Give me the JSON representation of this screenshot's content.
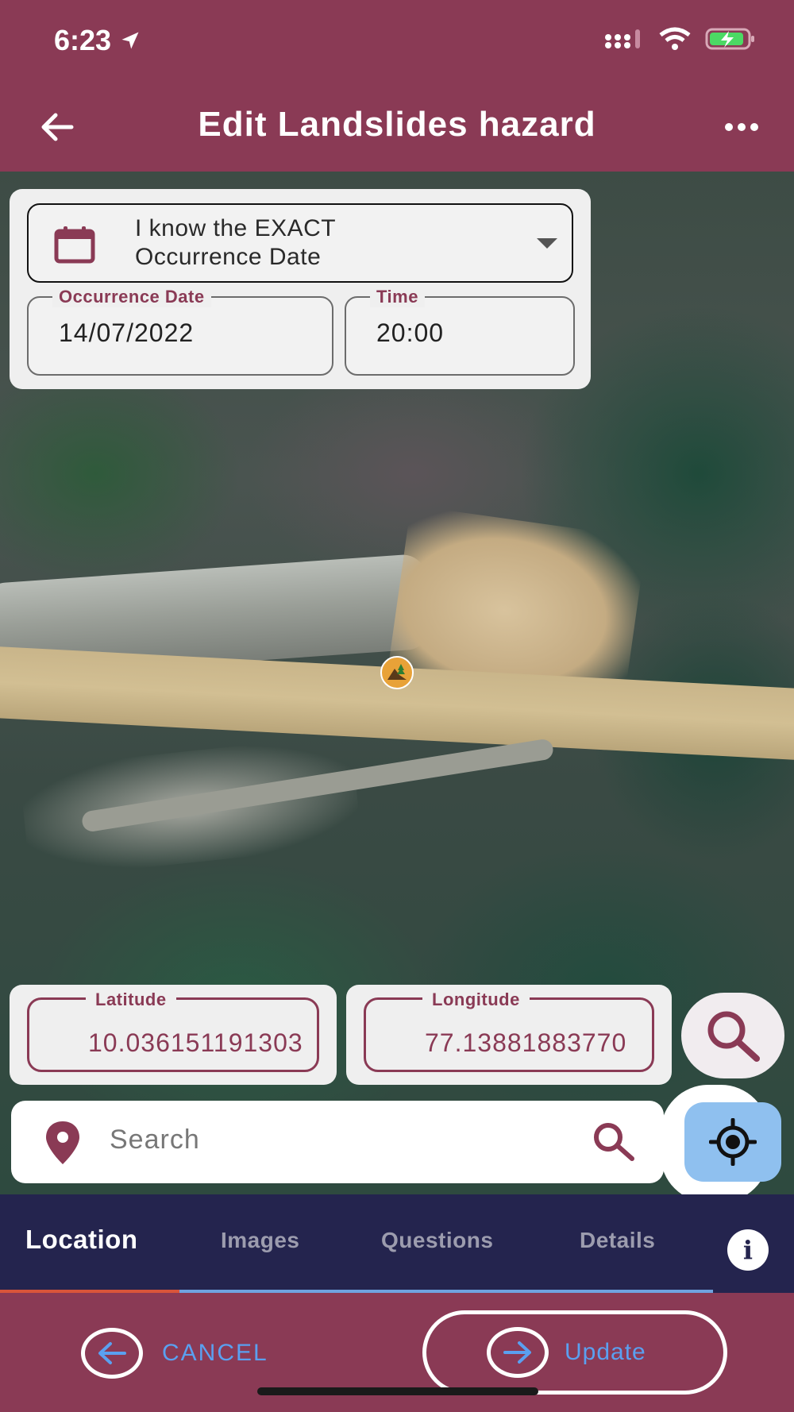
{
  "status_bar": {
    "time": "6:23",
    "icons": [
      "location-arrow-icon",
      "cellular-signal-icon",
      "wifi-icon",
      "battery-charging-icon"
    ]
  },
  "app_bar": {
    "title": "Edit Landslides hazard",
    "back_icon": "back-arrow-icon",
    "menu_icon": "more-horizontal-icon"
  },
  "date_card": {
    "date_mode": {
      "line1": "I know the EXACT",
      "line2": "Occurrence Date",
      "icon": "calendar-icon"
    },
    "occurrence_date": {
      "label": "Occurrence Date",
      "value": "14/07/2022"
    },
    "time": {
      "label": "Time",
      "value": "20:00"
    }
  },
  "map": {
    "marker_icon": "landslide-hazard-icon"
  },
  "coordinates": {
    "latitude": {
      "label": "Latitude",
      "value": "10.036151191303"
    },
    "longitude": {
      "label": "Longitude",
      "value": "77.13881883770"
    }
  },
  "search": {
    "placeholder": "Search",
    "pin_icon": "location-pin-icon",
    "search_icon": "search-icon"
  },
  "locate_button": {
    "icon": "gps-locate-icon"
  },
  "tabs": {
    "items": [
      {
        "label": "Location",
        "active": true
      },
      {
        "label": "Images",
        "active": false
      },
      {
        "label": "Questions",
        "active": false
      },
      {
        "label": "Details",
        "active": false
      }
    ],
    "info_label": "i"
  },
  "actions": {
    "cancel_label": "CANCEL",
    "update_label": "Update"
  },
  "colors": {
    "brand": "#8a3a55",
    "tabbar": "#24244e",
    "accent_blue": "#5aa0f0",
    "tab_indicator": "#d9553a"
  }
}
